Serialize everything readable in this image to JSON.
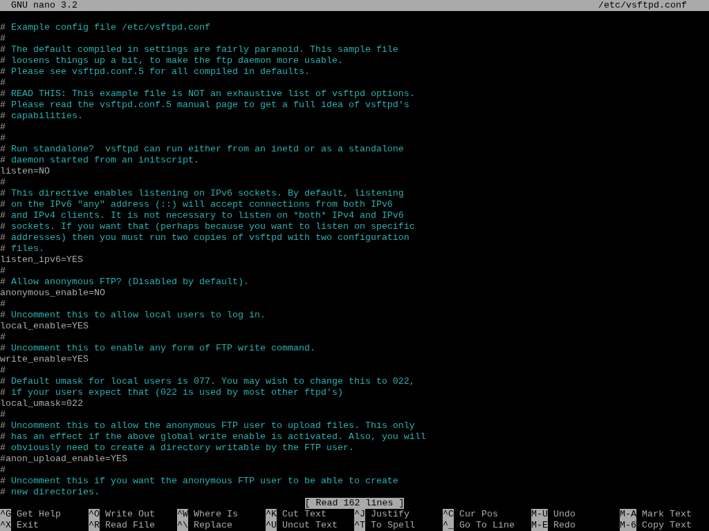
{
  "title_bar": {
    "app": "GNU nano 3.2",
    "file": "/etc/vsftpd.conf"
  },
  "lines": [
    {
      "kind": "comment",
      "text": "# Example config file /etc/vsftpd.conf"
    },
    {
      "kind": "comment",
      "text": "#"
    },
    {
      "kind": "comment",
      "text": "# The default compiled in settings are fairly paranoid. This sample file"
    },
    {
      "kind": "comment",
      "text": "# loosens things up a bit, to make the ftp daemon more usable."
    },
    {
      "kind": "comment",
      "text": "# Please see vsftpd.conf.5 for all compiled in defaults."
    },
    {
      "kind": "comment",
      "text": "#"
    },
    {
      "kind": "comment",
      "text": "# READ THIS: This example file is NOT an exhaustive list of vsftpd options."
    },
    {
      "kind": "comment",
      "text": "# Please read the vsftpd.conf.5 manual page to get a full idea of vsftpd's"
    },
    {
      "kind": "comment",
      "text": "# capabilities."
    },
    {
      "kind": "comment",
      "text": "#"
    },
    {
      "kind": "comment",
      "text": "#"
    },
    {
      "kind": "comment",
      "text": "# Run standalone?  vsftpd can run either from an inetd or as a standalone"
    },
    {
      "kind": "comment",
      "text": "# daemon started from an initscript."
    },
    {
      "kind": "setting",
      "text": "listen=NO"
    },
    {
      "kind": "comment",
      "text": "#"
    },
    {
      "kind": "comment",
      "text": "# This directive enables listening on IPv6 sockets. By default, listening"
    },
    {
      "kind": "comment",
      "text": "# on the IPv6 \"any\" address (::) will accept connections from both IPv6"
    },
    {
      "kind": "comment",
      "text": "# and IPv4 clients. It is not necessary to listen on *both* IPv4 and IPv6"
    },
    {
      "kind": "comment",
      "text": "# sockets. If you want that (perhaps because you want to listen on specific"
    },
    {
      "kind": "comment",
      "text": "# addresses) then you must run two copies of vsftpd with two configuration"
    },
    {
      "kind": "comment",
      "text": "# files."
    },
    {
      "kind": "setting",
      "text": "listen_ipv6=YES"
    },
    {
      "kind": "comment",
      "text": "#"
    },
    {
      "kind": "comment",
      "text": "# Allow anonymous FTP? (Disabled by default)."
    },
    {
      "kind": "setting",
      "text": "anonymous_enable=NO"
    },
    {
      "kind": "comment",
      "text": "#"
    },
    {
      "kind": "comment",
      "text": "# Uncomment this to allow local users to log in."
    },
    {
      "kind": "setting",
      "text": "local_enable=YES"
    },
    {
      "kind": "comment",
      "text": "#"
    },
    {
      "kind": "comment",
      "text": "# Uncomment this to enable any form of FTP write command."
    },
    {
      "kind": "setting",
      "text": "write_enable=YES"
    },
    {
      "kind": "comment",
      "text": "#"
    },
    {
      "kind": "comment",
      "text": "# Default umask for local users is 077. You may wish to change this to 022,"
    },
    {
      "kind": "comment",
      "text": "# if your users expect that (022 is used by most other ftpd's)"
    },
    {
      "kind": "setting",
      "text": "local_umask=022"
    },
    {
      "kind": "comment",
      "text": "#"
    },
    {
      "kind": "comment",
      "text": "# Uncomment this to allow the anonymous FTP user to upload files. This only"
    },
    {
      "kind": "comment",
      "text": "# has an effect if the above global write enable is activated. Also, you will"
    },
    {
      "kind": "comment",
      "text": "# obviously need to create a directory writable by the FTP user."
    },
    {
      "kind": "setting",
      "text": "#anon_upload_enable=YES"
    },
    {
      "kind": "comment",
      "text": "#"
    },
    {
      "kind": "comment",
      "text": "# Uncomment this if you want the anonymous FTP user to be able to create"
    },
    {
      "kind": "comment",
      "text": "# new directories."
    }
  ],
  "status_message": "[ Read 162 lines ]",
  "shortcuts": [
    [
      {
        "key": "^G",
        "label": "Get Help"
      },
      {
        "key": "^O",
        "label": "Write Out"
      },
      {
        "key": "^W",
        "label": "Where Is"
      },
      {
        "key": "^K",
        "label": "Cut Text"
      },
      {
        "key": "^J",
        "label": "Justify"
      },
      {
        "key": "^C",
        "label": "Cur Pos"
      },
      {
        "key": "M-U",
        "label": "Undo"
      },
      {
        "key": "M-A",
        "label": "Mark Text"
      }
    ],
    [
      {
        "key": "^X",
        "label": "Exit"
      },
      {
        "key": "^R",
        "label": "Read File"
      },
      {
        "key": "^\\",
        "label": "Replace"
      },
      {
        "key": "^U",
        "label": "Uncut Text"
      },
      {
        "key": "^T",
        "label": "To Spell"
      },
      {
        "key": "^_",
        "label": "Go To Line"
      },
      {
        "key": "M-E",
        "label": "Redo"
      },
      {
        "key": "M-6",
        "label": "Copy Text"
      }
    ]
  ]
}
